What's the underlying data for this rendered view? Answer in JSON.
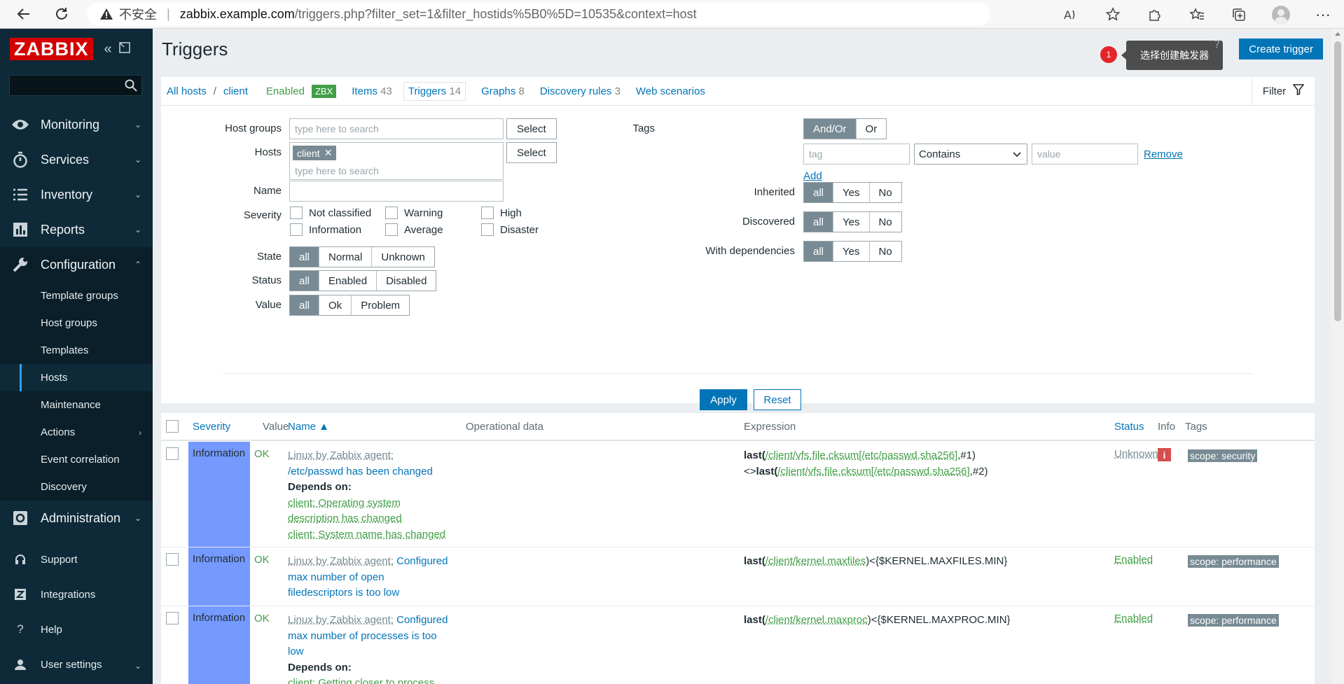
{
  "browser": {
    "insecure_label": "不安全",
    "url_host": "zabbix.example.com",
    "url_path": "/triggers.php?filter_set=1&filter_hostids%5B0%5D=10535&context=host"
  },
  "sidebar": {
    "logo": "ZABBIX",
    "menu": [
      {
        "label": "Monitoring"
      },
      {
        "label": "Services"
      },
      {
        "label": "Inventory"
      },
      {
        "label": "Reports"
      },
      {
        "label": "Configuration"
      }
    ],
    "config_submenu": [
      {
        "label": "Template groups"
      },
      {
        "label": "Host groups"
      },
      {
        "label": "Templates"
      },
      {
        "label": "Hosts"
      },
      {
        "label": "Maintenance"
      },
      {
        "label": "Actions"
      },
      {
        "label": "Event correlation"
      },
      {
        "label": "Discovery"
      }
    ],
    "administration": "Administration",
    "bottom": [
      {
        "label": "Support"
      },
      {
        "label": "Integrations"
      },
      {
        "label": "Help"
      },
      {
        "label": "User settings"
      }
    ]
  },
  "header": {
    "title": "Triggers",
    "create_button": "Create trigger",
    "badge_number": "1",
    "tooltip_text": "选择创建触发器",
    "tooltip_q": "?"
  },
  "nav": {
    "all_hosts": "All hosts",
    "separator": "/",
    "host": "client",
    "enabled": "Enabled",
    "zbx": "ZBX",
    "items_label": "Items",
    "items_count": "43",
    "triggers_label": "Triggers",
    "triggers_count": "14",
    "graphs_label": "Graphs",
    "graphs_count": "8",
    "discovery_label": "Discovery rules",
    "discovery_count": "3",
    "web_label": "Web scenarios",
    "filter_label": "Filter"
  },
  "filter": {
    "host_groups_label": "Host groups",
    "host_groups_placeholder": "type here to search",
    "select_label": "Select",
    "hosts_label": "Hosts",
    "host_chip": "client",
    "chip_remove": "✕",
    "hosts_placeholder": "type here to search",
    "name_label": "Name",
    "severity_label": "Severity",
    "severities": [
      "Not classified",
      "Warning",
      "High",
      "Information",
      "Average",
      "Disaster"
    ],
    "state_label": "State",
    "state_options": [
      "all",
      "Normal",
      "Unknown"
    ],
    "status_label": "Status",
    "status_options": [
      "all",
      "Enabled",
      "Disabled"
    ],
    "value_label": "Value",
    "value_options": [
      "all",
      "Ok",
      "Problem"
    ],
    "tags_label": "Tags",
    "tags_options": [
      "And/Or",
      "Or"
    ],
    "tag_placeholder": "tag",
    "tag_operator": "Contains",
    "value_placeholder": "value",
    "remove_label": "Remove",
    "add_label": "Add",
    "inherited_label": "Inherited",
    "discovered_label": "Discovered",
    "with_dependencies_label": "With dependencies",
    "tri_options": [
      "all",
      "Yes",
      "No"
    ],
    "apply_label": "Apply",
    "reset_label": "Reset"
  },
  "table": {
    "headers": {
      "severity": "Severity",
      "value": "Value",
      "name": "Name ▲",
      "operational_data": "Operational data",
      "expression": "Expression",
      "status": "Status",
      "info": "Info",
      "tags": "Tags"
    },
    "rows": [
      {
        "severity": "Information",
        "value": "OK",
        "name_prefix": "Linux by Zabbix agent:",
        "name_link": "/etc/passwd has been changed",
        "depends_label": "Depends on:",
        "depends": [
          "client: Operating system description has changed",
          "client: System name has changed"
        ],
        "expr_fn1": "last(",
        "expr_item1": "/client/vfs.file.cksum[/etc/passwd,sha256]",
        "expr_mid": ",#1)<>",
        "expr_fn2": "last(",
        "expr_item2": "/client/vfs.file.cksum[/etc/passwd,sha256]",
        "expr_end": ",#2)",
        "status": "Unknown",
        "info": "i",
        "tag": "scope: security"
      },
      {
        "severity": "Information",
        "value": "OK",
        "name_prefix": "Linux by Zabbix agent:",
        "name_link": "Configured max number of open filedescriptors is too low",
        "expr_fn1": "last(",
        "expr_item1": "/client/kernel.maxfiles",
        "expr_end": ")<{$KERNEL.MAXFILES.MIN}",
        "status": "Enabled",
        "tag": "scope: performance"
      },
      {
        "severity": "Information",
        "value": "OK",
        "name_prefix": "Linux by Zabbix agent:",
        "name_link": "Configured max number of processes is too low",
        "depends_label": "Depends on:",
        "depends": [
          "client: Getting closer to process"
        ],
        "expr_fn1": "last(",
        "expr_item1": "/client/kernel.maxproc",
        "expr_end": ")<{$KERNEL.MAXPROC.MIN}",
        "status": "Enabled",
        "tag": "scope: performance"
      }
    ]
  }
}
